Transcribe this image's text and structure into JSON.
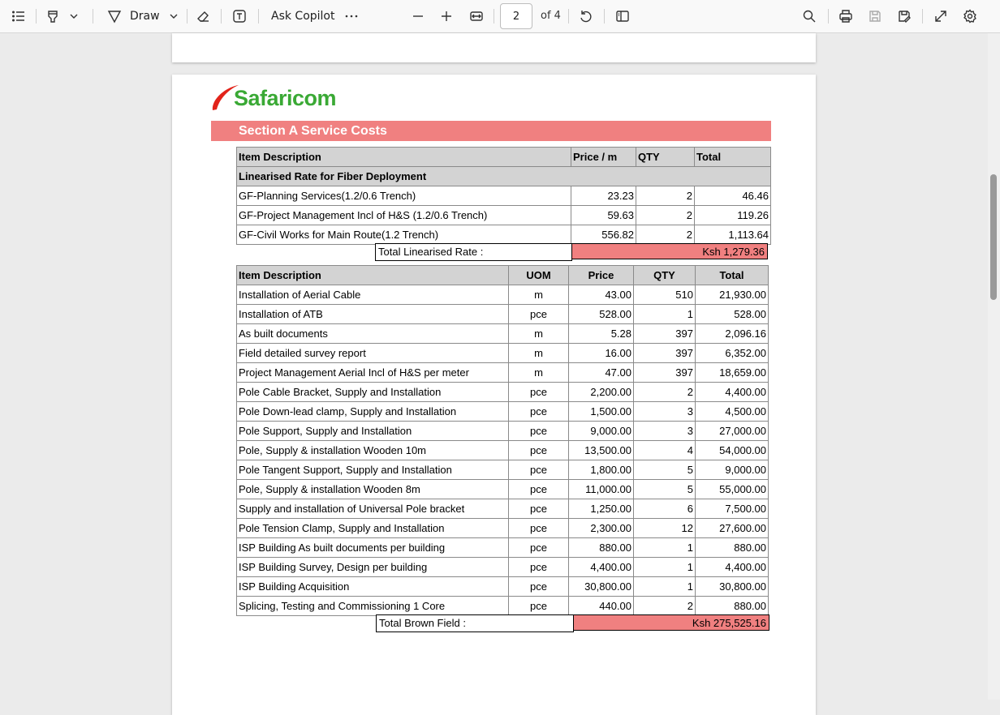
{
  "toolbar": {
    "draw_label": "Draw",
    "copilot_label": "Ask Copilot",
    "page_number": "2",
    "page_total": "of 4"
  },
  "document": {
    "logo_text": "Safaricom",
    "section_title": "Section A Service Costs",
    "table1": {
      "headers": [
        "Item Description",
        "Price / m",
        "QTY",
        "Total"
      ],
      "subheader": "Linearised Rate for Fiber Deployment",
      "rows": [
        {
          "desc": "GF-Planning Services(1.2/0.6 Trench)",
          "price": "23.23",
          "qty": "2",
          "total": "46.46"
        },
        {
          "desc": "GF-Project Management Incl of H&S (1.2/0.6 Trench)",
          "price": "59.63",
          "qty": "2",
          "total": "119.26"
        },
        {
          "desc": "GF-Civil Works for Main Route(1.2 Trench)",
          "price": "556.82",
          "qty": "2",
          "total": "1,113.64"
        }
      ],
      "total_label": "Total Linearised Rate :",
      "total_value": "Ksh 1,279.36"
    },
    "table2": {
      "headers": [
        "Item Description",
        "UOM",
        "Price",
        "QTY",
        "Total"
      ],
      "rows": [
        {
          "desc": "Installation of Aerial Cable",
          "uom": "m",
          "price": "43.00",
          "qty": "510",
          "total": "21,930.00"
        },
        {
          "desc": "Installation of ATB",
          "uom": "pce",
          "price": "528.00",
          "qty": "1",
          "total": "528.00"
        },
        {
          "desc": " As built documents",
          "uom": "m",
          "price": "5.28",
          "qty": "397",
          "total": "2,096.16"
        },
        {
          "desc": " Field detailed survey report",
          "uom": "m",
          "price": "16.00",
          "qty": "397",
          "total": "6,352.00"
        },
        {
          "desc": "Project Management Aerial Incl of H&S per meter",
          "uom": "m",
          "price": "47.00",
          "qty": "397",
          "total": "18,659.00"
        },
        {
          "desc": "Pole Cable Bracket, Supply and Installation",
          "uom": "pce",
          "price": "2,200.00",
          "qty": "2",
          "total": "4,400.00"
        },
        {
          "desc": "Pole Down-lead clamp, Supply and Installation",
          "uom": "pce",
          "price": "1,500.00",
          "qty": "3",
          "total": "4,500.00"
        },
        {
          "desc": "Pole Support, Supply and Installation",
          "uom": "pce",
          "price": "9,000.00",
          "qty": "3",
          "total": "27,000.00"
        },
        {
          "desc": "Pole, Supply & installation Wooden 10m",
          "uom": "pce",
          "price": "13,500.00",
          "qty": "4",
          "total": "54,000.00"
        },
        {
          "desc": "Pole Tangent Support, Supply and Installation",
          "uom": "pce",
          "price": "1,800.00",
          "qty": "5",
          "total": "9,000.00"
        },
        {
          "desc": "Pole, Supply & installation Wooden 8m",
          "uom": "pce",
          "price": "11,000.00",
          "qty": "5",
          "total": "55,000.00"
        },
        {
          "desc": "Supply and installation of Universal Pole bracket",
          "uom": "pce",
          "price": "1,250.00",
          "qty": "6",
          "total": "7,500.00"
        },
        {
          "desc": "Pole Tension Clamp, Supply and Installation",
          "uom": "pce",
          "price": "2,300.00",
          "qty": "12",
          "total": "27,600.00"
        },
        {
          "desc": "ISP Building As built documents per building",
          "uom": "pce",
          "price": "880.00",
          "qty": "1",
          "total": "880.00"
        },
        {
          "desc": "ISP Building Survey, Design per building",
          "uom": "pce",
          "price": "4,400.00",
          "qty": "1",
          "total": "4,400.00"
        },
        {
          "desc": "ISP Building Acquisition",
          "uom": "pce",
          "price": "30,800.00",
          "qty": "1",
          "total": "30,800.00"
        },
        {
          "desc": "Splicing, Testing and Commissioning  1 Core",
          "uom": "pce",
          "price": "440.00",
          "qty": "2",
          "total": "880.00"
        }
      ],
      "total_label": "Total Brown Field :",
      "total_value": "Ksh 275,525.16"
    }
  },
  "colors": {
    "accent_red": "#f08080",
    "logo_green": "#3aa935",
    "logo_red": "#e2231a"
  }
}
